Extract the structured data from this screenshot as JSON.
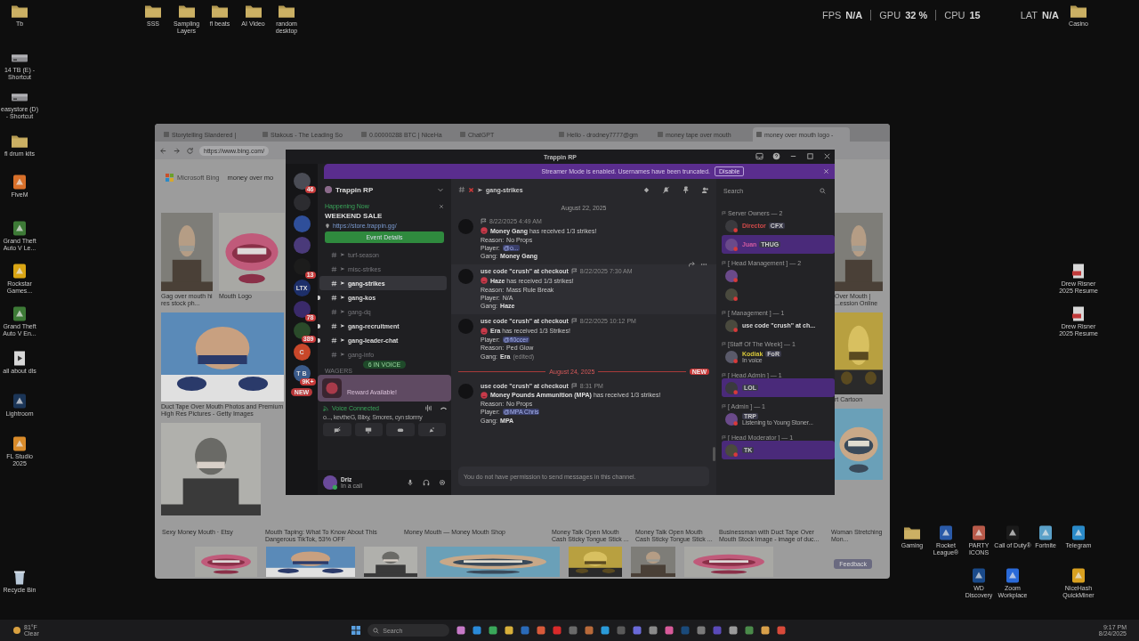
{
  "overlay": {
    "fps_label": "FPS",
    "fps": "N/A",
    "gpu_label": "GPU",
    "gpu": "32 %",
    "cpu_label": "CPU",
    "cpu": "15",
    "lat_label": "LAT",
    "lat": "N/A"
  },
  "desktop": {
    "left": [
      {
        "label": "Tb",
        "kind": "folder"
      },
      {
        "label": "14 TB (E) - Shortcut",
        "kind": "drive"
      },
      {
        "label": "easystore (D) - Shortcut",
        "kind": "drive"
      },
      {
        "label": "fl drum kits",
        "kind": "folder"
      },
      {
        "label": "FiveM",
        "kind": "app",
        "color": "#d8702a"
      },
      {
        "label": "Grand Theft Auto V Le...",
        "kind": "app",
        "color": "#3d7a36"
      },
      {
        "label": "Rockstar Games...",
        "kind": "app",
        "color": "#d9a514"
      },
      {
        "label": "Grand Theft Auto V En...",
        "kind": "app",
        "color": "#3d7a36"
      },
      {
        "label": "all about dls",
        "kind": "file"
      },
      {
        "label": "Lightroom",
        "kind": "app",
        "color": "#1b3557"
      },
      {
        "label": "FL Studio 2025",
        "kind": "app",
        "color": "#d98b2a"
      }
    ],
    "top": [
      {
        "label": "SSS",
        "kind": "folder"
      },
      {
        "label": "Sampling Layers",
        "kind": "folder"
      },
      {
        "label": "fl beats",
        "kind": "folder"
      },
      {
        "label": "AI Video",
        "kind": "folder"
      },
      {
        "label": "random desktop",
        "kind": "folder"
      }
    ],
    "right_top": [
      {
        "label": "Casino",
        "kind": "folder"
      }
    ],
    "right_files": [
      {
        "label": "Drew Risner 2025 Resume",
        "kind": "pdf"
      },
      {
        "label": "Drew Risner 2025 Resume",
        "kind": "pdf"
      }
    ],
    "right_row1": [
      {
        "label": "Gaming",
        "kind": "folder"
      },
      {
        "label": "Rocket League®",
        "kind": "app",
        "color": "#2a5aa8"
      },
      {
        "label": "PARTY ICONS",
        "kind": "app",
        "color": "#b85a4a"
      },
      {
        "label": "Call of Duty®",
        "kind": "app",
        "color": "#1a1a1a"
      },
      {
        "label": "Fortnite",
        "kind": "app",
        "color": "#5aa0c8"
      },
      {
        "label": "Telegram",
        "kind": "app",
        "color": "#2a8ac8"
      }
    ],
    "right_row2": [
      {
        "label": "WD Discovery",
        "kind": "app",
        "color": "#1a4a8a"
      },
      {
        "label": "Zoom Workplace",
        "kind": "app",
        "color": "#2a6ad8"
      },
      {
        "label": "NiceHash QuickMiner",
        "kind": "app",
        "color": "#d8a020"
      }
    ],
    "bottom_left": [
      {
        "label": "Recycle Bin",
        "kind": "bin"
      }
    ]
  },
  "browser": {
    "tabs": [
      {
        "label": "Storytelling Slandered |",
        "selected": false
      },
      {
        "label": "Stakous - The Leading So",
        "selected": false
      },
      {
        "label": "0.00000288 BTC | NiceHa",
        "selected": false
      },
      {
        "label": "ChatGPT",
        "selected": false
      },
      {
        "label": "Hello - drodney7777@gm",
        "selected": false
      },
      {
        "label": "money tape over mouth",
        "selected": false
      },
      {
        "label": "money over mouth logo -",
        "selected": true
      }
    ],
    "url": "https://www.bing.com/",
    "brand": "Microsoft Bing",
    "query": "money over mo",
    "left_row1": [
      "Gag over mouth hi res stock ph...",
      "Mouth Logo"
    ],
    "left_row2": [
      "Duct Tape Over Mouth Photos and Premium High Res Pictures - Getty Images"
    ],
    "right_row1": [
      "Over Mouth | ...ession Online"
    ],
    "right_row2": [
      "rt Cartoon"
    ],
    "bottom_captions": [
      "Sexy Money Mouth · Etsy",
      "Mouth Taping: What To Know About This Dangerous TikTok, 53% OFF",
      "Money Mouth — Money Mouth Shop",
      "Money Talk Open Mouth Cash Sticky Tongue Stick ...",
      "Money Talk Open Mouth Cash Sticky Tongue Stick ...",
      "Businessman with Duct Tape Over Mouth Stock Image - image of duc...",
      "Woman Stretching Mon..."
    ],
    "feedback": "Feedback"
  },
  "discord": {
    "title": "Trappin RP",
    "banner": {
      "text": "Streamer Mode is enabled. Usernames have been truncated.",
      "button": "Disable"
    },
    "servers": [
      {
        "color": "#4a4c55",
        "badge": "46"
      },
      {
        "color": "#2c2c30"
      },
      {
        "color": "#2f4f9a"
      },
      {
        "color": "#4a3a7a"
      },
      {
        "color": "#1c1c1c",
        "badge": "13"
      },
      {
        "color": "#1d2f6a",
        "label": "LTX"
      },
      {
        "color": "#3a2a6a",
        "badge": "78"
      },
      {
        "color": "#2a4a2a",
        "badge": "389"
      },
      {
        "color": "#c8472a",
        "label": "C"
      },
      {
        "color": "#3a5a8a",
        "label": "T B",
        "badge": "9K+"
      }
    ],
    "new_pill": "NEW",
    "server_name": "Trappin RP",
    "event": {
      "status": "Happening Now",
      "title": "WEEKEND SALE",
      "link": "https://store.trappin.gg/",
      "button": "Event Details"
    },
    "channels": [
      {
        "name": "turf-season",
        "selected": false,
        "unread": false
      },
      {
        "name": "misc-strikes",
        "selected": false,
        "unread": false
      },
      {
        "name": "gang-strikes",
        "selected": true,
        "unread": false
      },
      {
        "name": "gang-kos",
        "selected": false,
        "unread": true
      },
      {
        "name": "gang-dq",
        "selected": false,
        "unread": false
      },
      {
        "name": "gang-recruitment",
        "selected": false,
        "unread": true
      },
      {
        "name": "gang-leader-chat",
        "selected": false,
        "unread": true
      },
      {
        "name": "gang-info",
        "selected": false,
        "unread": false
      }
    ],
    "voice_pill": "6 IN VOICE",
    "category": "WAGERS",
    "reward": "Reward Available!",
    "voice": {
      "title": "Voice Connected",
      "people": "o..., kevtheG, Blixy, Smores, cyn stormy"
    },
    "user": {
      "name": "Driz",
      "status": "In a call"
    },
    "channel_title": "gang-strikes",
    "date1": "August 22, 2025",
    "messages": [
      {
        "time": "8/22/2025 4:49 AM",
        "headline": "**Money Gang** has received 1/3 strikes!",
        "hovered": false,
        "fields": [
          {
            "label": "Reason:",
            "value": "No Props",
            "kind": "text"
          },
          {
            "label": "Player:",
            "value": "@o...",
            "kind": "mention"
          },
          {
            "label": "Gang:",
            "value": "Money Gang",
            "kind": "bold"
          }
        ]
      },
      {
        "author": "use code \"crush\" at checkout",
        "time": "8/22/2025 7:30 AM",
        "headline": "**Haze** has received 1/3 strikes!",
        "hovered": true,
        "fields": [
          {
            "label": "Reason:",
            "value": "Mass Rule Break",
            "kind": "text"
          },
          {
            "label": "Player:",
            "value": "N/A",
            "kind": "text"
          },
          {
            "label": "Gang:",
            "value": "Haze",
            "kind": "bold"
          }
        ]
      },
      {
        "author": "use code \"crush\" at checkout",
        "time": "8/22/2025 10:12 PM",
        "headline": "**Era** has received 1/3 Strikes!",
        "hovered": false,
        "fields": [
          {
            "label": "Player:",
            "value": "@fl0ccer",
            "kind": "mention"
          },
          {
            "label": "Reason:",
            "value": "Ped Glow",
            "kind": "text"
          },
          {
            "label": "Gang:",
            "value": "Era",
            "kind": "bold",
            "note": "(edited)"
          }
        ]
      }
    ],
    "date2": "August 24, 2025",
    "new_label": "NEW",
    "messages2": [
      {
        "author": "use code \"crush\" at checkout",
        "time": "8:31 PM",
        "headline": "**Money Pounds Ammunition (MPA)** has received 1/3 strikes!",
        "hovered": false,
        "fields": [
          {
            "label": "Reason:",
            "value": "No Props",
            "kind": "text"
          },
          {
            "label": "Player:",
            "value": "@MPA Chris",
            "kind": "mention"
          },
          {
            "label": "Gang:",
            "value": "MPA",
            "kind": "bold"
          }
        ]
      }
    ],
    "composer": "You do not have permission to send messages in this channel.",
    "member_search": "Search",
    "member_groups": [
      {
        "title": "Server Owners — 2",
        "members": [
          {
            "name": "Director",
            "color": "#d04a4a",
            "tag": "CFX",
            "banner": false
          },
          {
            "name": "Juan",
            "color": "#d05aa0",
            "tag": "THUG",
            "banner": true
          }
        ]
      },
      {
        "title": "[ Head Management ] — 2",
        "members": [
          {
            "banner": false
          },
          {
            "banner": false
          }
        ]
      },
      {
        "title": "[ Management ] — 1",
        "members": [
          {
            "name": "use code \"crush\" at ch...",
            "color": "#dcdcdc",
            "banner": false
          }
        ]
      },
      {
        "title": "[Staff Of The Week] — 1",
        "members": [
          {
            "name": "Kodiak",
            "color": "#d8c83a",
            "tag": "FoR",
            "status": "In voice",
            "banner": false
          }
        ]
      },
      {
        "title": "[ Head Admin ] — 1",
        "members": [
          {
            "tag": "LOL",
            "banner": true
          }
        ]
      },
      {
        "title": "[ Admin ] — 1",
        "members": [
          {
            "tag": "TRP",
            "status": "Listening to Young Stoner...",
            "banner": false
          }
        ]
      },
      {
        "title": "[ Head Moderator ] — 1",
        "members": [
          {
            "tag": "TK",
            "banner": true
          }
        ]
      }
    ]
  },
  "taskbar": {
    "weather_temp": "81°F",
    "weather_text": "Clear",
    "search": "Search",
    "apps": [
      {
        "color": "#c87ac8"
      },
      {
        "color": "#2a8ad8"
      },
      {
        "color": "#3aa85a"
      },
      {
        "color": "#d8b03a"
      },
      {
        "color": "#2a6ab8"
      },
      {
        "color": "#d85a3a"
      },
      {
        "color": "#d82a2a"
      },
      {
        "color": "#6a6a6a"
      },
      {
        "color": "#b86a3a"
      },
      {
        "color": "#2a9ad8"
      },
      {
        "color": "#5a5a5a"
      },
      {
        "color": "#6a6ad8"
      },
      {
        "color": "#8a8a8a"
      },
      {
        "color": "#d85a9a"
      },
      {
        "color": "#1a4a7a"
      },
      {
        "color": "#7a7a7a"
      },
      {
        "color": "#5a4ab8"
      },
      {
        "color": "#9a9a9a"
      },
      {
        "color": "#4a8a4a"
      },
      {
        "color": "#d8a04a"
      },
      {
        "color": "#d84a3a"
      }
    ],
    "time": "9:17 PM",
    "date": "8/24/2025"
  }
}
